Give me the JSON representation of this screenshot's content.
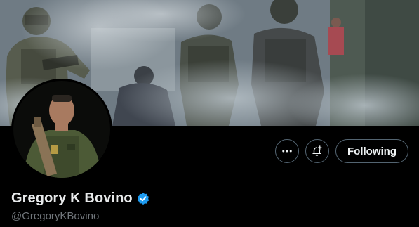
{
  "profile": {
    "display_name": "Gregory K Bovino",
    "handle": "@GregoryKBovino",
    "verified": true,
    "verified_color": "#1d9bf0"
  },
  "actions": {
    "more_icon": "more-horizontal-icon",
    "notify_icon": "bell-plus-icon",
    "follow_label": "Following"
  },
  "banner": {
    "description_icon": "banner-photo"
  },
  "colors": {
    "background": "#000000",
    "text_primary": "#e7e9ea",
    "text_secondary": "#71767b",
    "button_border": "#536471"
  }
}
